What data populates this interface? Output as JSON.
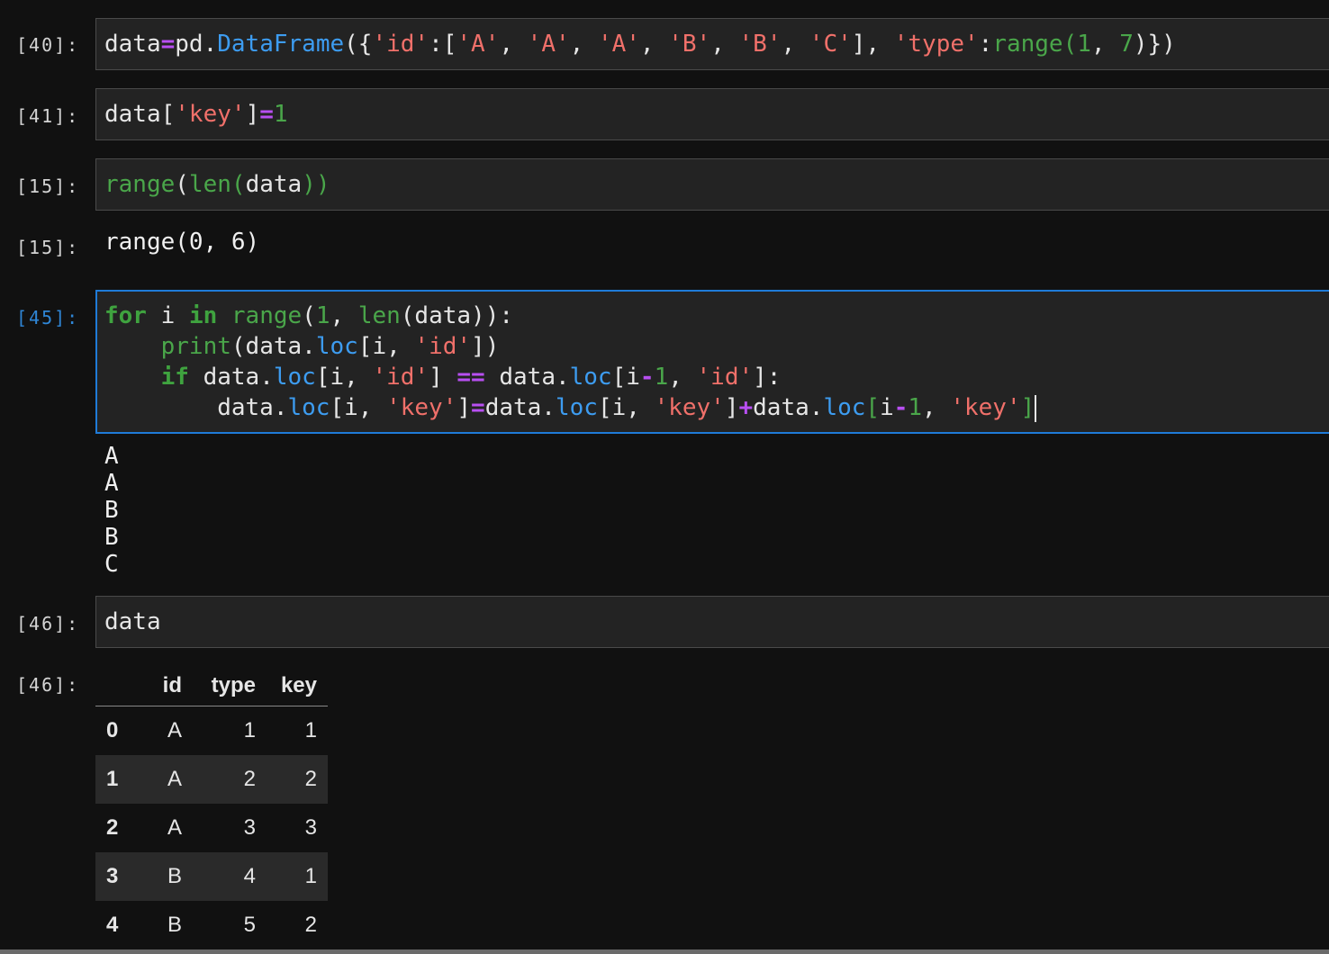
{
  "cells": [
    {
      "prompt": "[40]:"
    },
    {
      "prompt": "[41]:"
    },
    {
      "prompt": "[15]:",
      "out_prompt": "[15]:",
      "output": "range(0, 6)"
    },
    {
      "prompt": "[45]:",
      "output_lines": [
        "A",
        "A",
        "B",
        "B",
        "C"
      ]
    },
    {
      "prompt": "[46]:",
      "out_prompt": "[46]:"
    }
  ],
  "code": {
    "c40": [
      "data",
      "=",
      "pd",
      ".",
      "DataFrame",
      "({",
      "'id'",
      ":[",
      "'A'",
      ", ",
      "'A'",
      ", ",
      "'A'",
      ", ",
      "'B'",
      ", ",
      "'B'",
      ", ",
      "'C'",
      "], ",
      "'type'",
      ":",
      "range",
      "(",
      "1",
      ", ",
      "7",
      ")})"
    ],
    "c41": [
      "data[",
      "'key'",
      "]",
      "=",
      "1"
    ],
    "c15": [
      "range",
      "(",
      "len",
      "(",
      "data",
      "))"
    ],
    "c45": [
      [
        "for",
        " i ",
        "in",
        " ",
        "range",
        "(",
        "1",
        ", ",
        "len",
        "(data)):"
      ],
      [
        "    ",
        "print",
        "(data.",
        "loc",
        "[i, ",
        "'id'",
        "])"
      ],
      [
        "    ",
        "if",
        " data.",
        "loc",
        "[i, ",
        "'id'",
        "] ",
        "==",
        " data.",
        "loc",
        "[i",
        "-",
        "1",
        ", ",
        "'id'",
        "]:"
      ],
      [
        "        data.",
        "loc",
        "[i, ",
        "'key'",
        "]",
        "=",
        "data.",
        "loc",
        "[i, ",
        "'key'",
        "]",
        "+",
        "data.",
        "loc",
        "[",
        "i",
        "-",
        "1",
        ", ",
        "'key'",
        "]"
      ]
    ],
    "c46": [
      "data"
    ]
  },
  "dataframe": {
    "columns": [
      "",
      "id",
      "type",
      "key"
    ],
    "rows": [
      [
        "0",
        "A",
        "1",
        "1"
      ],
      [
        "1",
        "A",
        "2",
        "2"
      ],
      [
        "2",
        "A",
        "3",
        "3"
      ],
      [
        "3",
        "B",
        "4",
        "1"
      ],
      [
        "4",
        "B",
        "5",
        "2"
      ]
    ]
  }
}
